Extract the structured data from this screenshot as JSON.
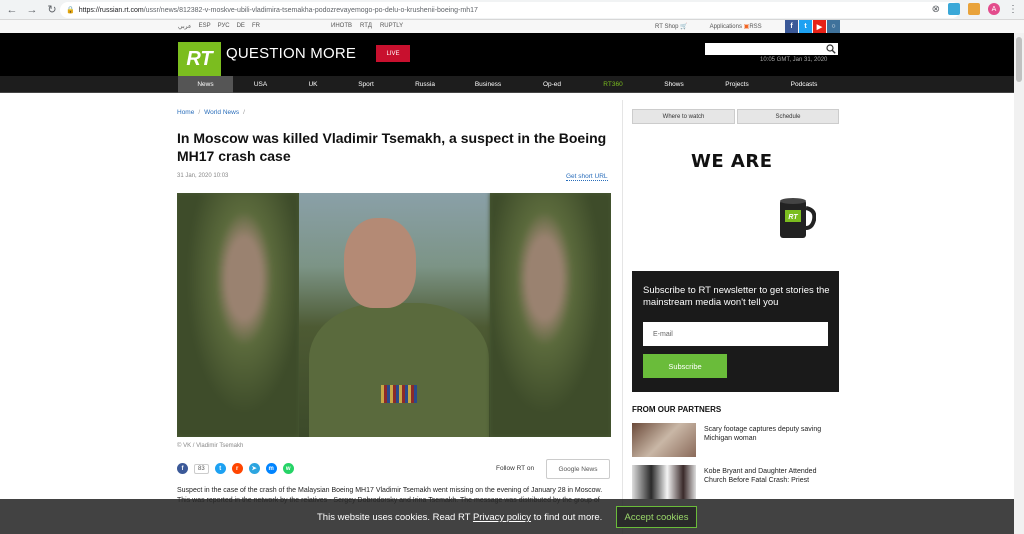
{
  "browser": {
    "url_domain": "https://russian.rt.com",
    "url_path": "/ussr/news/812382-v-moskve-ubili-vladimira-tsemakha-podozrevayemogo-po-delu-o-krushenii-boeing-mh17",
    "avatar_letter": "A"
  },
  "utility": {
    "langs": [
      "عربي",
      "ESP",
      "РУС",
      "DE",
      "FR"
    ],
    "mid_links": [
      "ИНОТВ",
      "RTД",
      "RUPTLY"
    ],
    "rt_shop": "RT Shop",
    "applications": "Applications",
    "rss": "RSS"
  },
  "header": {
    "logo": "RT",
    "tagline": "QUESTION MORE",
    "live_label": "LIVE",
    "timestamp": "10:05 GMT, Jan 31, 2020"
  },
  "nav": {
    "items": [
      "News",
      "USA",
      "UK",
      "Sport",
      "Russia",
      "Business",
      "Op-ed",
      "RT360",
      "Shows",
      "Projects",
      "Podcasts"
    ]
  },
  "article": {
    "breadcrumb": [
      "Home",
      "World News"
    ],
    "title": "In Moscow was killed Vladimir Tsemakh, a suspect in the Boeing MH17 crash case",
    "date": "31 Jan, 2020 10:03",
    "short_url": "Get short URL",
    "photo_caption": "© VK / Vladimir Tsemakh",
    "share_count": "83",
    "follow_label": "Follow RT on",
    "google_news": "Google News",
    "lead": "Suspect in the case of the crash of the Malaysian Boeing MH17 Vladimir Tsemakh went missing on the evening of January 28 in Moscow. This was reported in the network by the relatives - Sergey Dobrodorsky and Irina Tsemakh. The message was distributed by the group of"
  },
  "sidebar": {
    "tabs": [
      "Where to watch",
      "Schedule"
    ],
    "promo_title": "WE ARE",
    "newsletter_text": "Subscribe to RT newsletter to get stories the mainstream media won't tell you",
    "email_placeholder": "E-mail",
    "subscribe_label": "Subscribe",
    "partners_heading": "FROM OUR PARTNERS",
    "partners": [
      "Scary footage captures deputy saving Michigan woman",
      "Kobe Bryant and Daughter Attended Church Before Fatal Crash: Priest"
    ]
  },
  "cookie": {
    "msg_before": "This website uses cookies. Read RT",
    "msg_link": "Privacy policy",
    "msg_after": "to find out more.",
    "accept": "Accept cookies"
  },
  "colors": {
    "brand_green": "#7bbd1f",
    "live_red": "#c8102e",
    "link_blue": "#2a6ebb"
  }
}
